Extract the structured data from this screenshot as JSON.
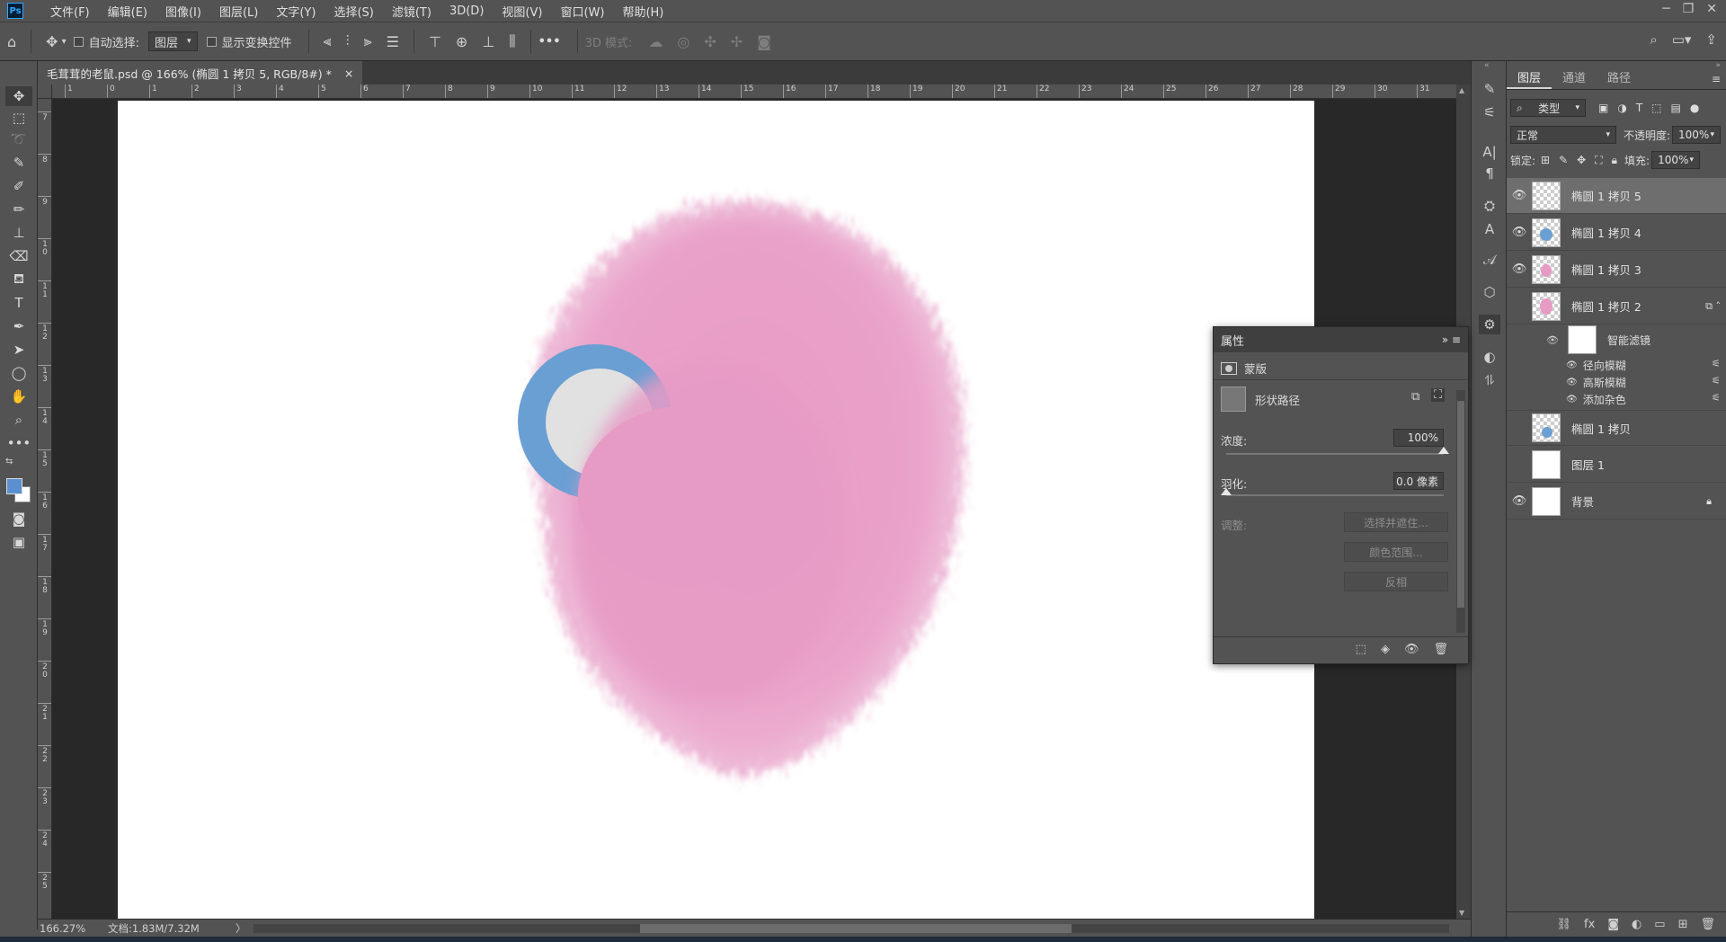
{
  "app": {
    "logo": "Ps"
  },
  "menu": [
    "文件(F)",
    "编辑(E)",
    "图像(I)",
    "图层(L)",
    "文字(Y)",
    "选择(S)",
    "滤镜(T)",
    "3D(D)",
    "视图(V)",
    "窗口(W)",
    "帮助(H)"
  ],
  "options": {
    "auto_select_label": "自动选择:",
    "auto_select_value": "图层",
    "show_transform_label": "显示变换控件",
    "more": "•••",
    "mode_3d_label": "3D 模式:"
  },
  "document": {
    "tab_title": "毛茸茸的老鼠.psd @ 166% (椭圆 1 拷贝 5, RGB/8#) *",
    "close": "×"
  },
  "ruler": {
    "h_labels": [
      "1",
      "0",
      "1",
      "2",
      "3",
      "4",
      "5",
      "6",
      "7",
      "8",
      "9",
      "10",
      "11",
      "12",
      "13",
      "14",
      "15",
      "16",
      "17",
      "18",
      "19",
      "20",
      "21",
      "22",
      "23",
      "24",
      "25",
      "26",
      "27",
      "28",
      "29",
      "30",
      "31"
    ],
    "v_labels": [
      "7",
      "8",
      "9",
      "10",
      "11",
      "12",
      "13",
      "14",
      "15",
      "16",
      "17",
      "18",
      "19",
      "20",
      "21",
      "22",
      "23",
      "24",
      "25"
    ]
  },
  "status": {
    "zoom": "166.27%",
    "doc_info": "文档:1.83M/7.32M",
    "arrow": "〉"
  },
  "layers_panel": {
    "tabs": [
      "图层",
      "通道",
      "路径"
    ],
    "filter_kind": "类型",
    "blend_mode": "正常",
    "opacity_label": "不透明度:",
    "opacity_value": "100%",
    "lock_label": "锁定:",
    "fill_label": "填充:",
    "fill_value": "100%",
    "layers": [
      {
        "name": "椭圆 1 拷贝 5",
        "visible": true,
        "selected": true
      },
      {
        "name": "椭圆 1 拷贝 4",
        "visible": true,
        "selected": false
      },
      {
        "name": "椭圆 1 拷贝 3",
        "visible": true,
        "selected": false
      },
      {
        "name": "椭圆 1 拷贝 2",
        "visible": false,
        "selected": false
      },
      {
        "name": "椭圆 1 拷贝",
        "visible": false,
        "selected": false
      },
      {
        "name": "图层 1",
        "visible": false,
        "selected": false
      },
      {
        "name": "背景",
        "visible": true,
        "selected": false
      }
    ],
    "smart_filters": {
      "title": "智能滤镜",
      "items": [
        "径向模糊",
        "高斯模糊",
        "添加杂色"
      ]
    }
  },
  "properties": {
    "title": "属性",
    "mask_label": "蒙版",
    "shape_path_label": "形状路径",
    "density_label": "浓度:",
    "density_value": "100%",
    "feather_label": "羽化:",
    "feather_value": "0.0 像素",
    "adjust_label": "调整:",
    "btn_select_mask": "选择并遮住...",
    "btn_color_range": "颜色范围...",
    "btn_invert": "反相"
  },
  "colors": {
    "fur_pink": "#e89cc6",
    "ring_blue": "#6a9fd3",
    "inner_gray": "#e1e1e1",
    "foreground": "#5b8fd0",
    "background": "#ffffff"
  }
}
